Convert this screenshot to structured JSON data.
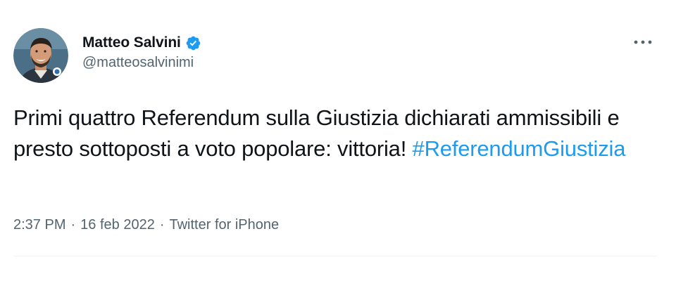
{
  "author": {
    "display_name": "Matteo Salvini",
    "handle": "@matteosalvinimi",
    "verified": true,
    "verified_icon": "verified-badge-icon",
    "verified_color": "#1d9bf0"
  },
  "tweet": {
    "text": "Primi quattro Referendum sulla Giustizia dichiarati ammissibili e presto sottoposti a voto popolare: vittoria! ",
    "hashtag": "#ReferendumGiustizia",
    "hashtag_color": "#1d9bf0"
  },
  "meta": {
    "time": "2:37 PM",
    "separator": "·",
    "date": "16 feb 2022",
    "source": "Twitter for iPhone"
  },
  "menu": {
    "icon": "more-options-icon"
  }
}
